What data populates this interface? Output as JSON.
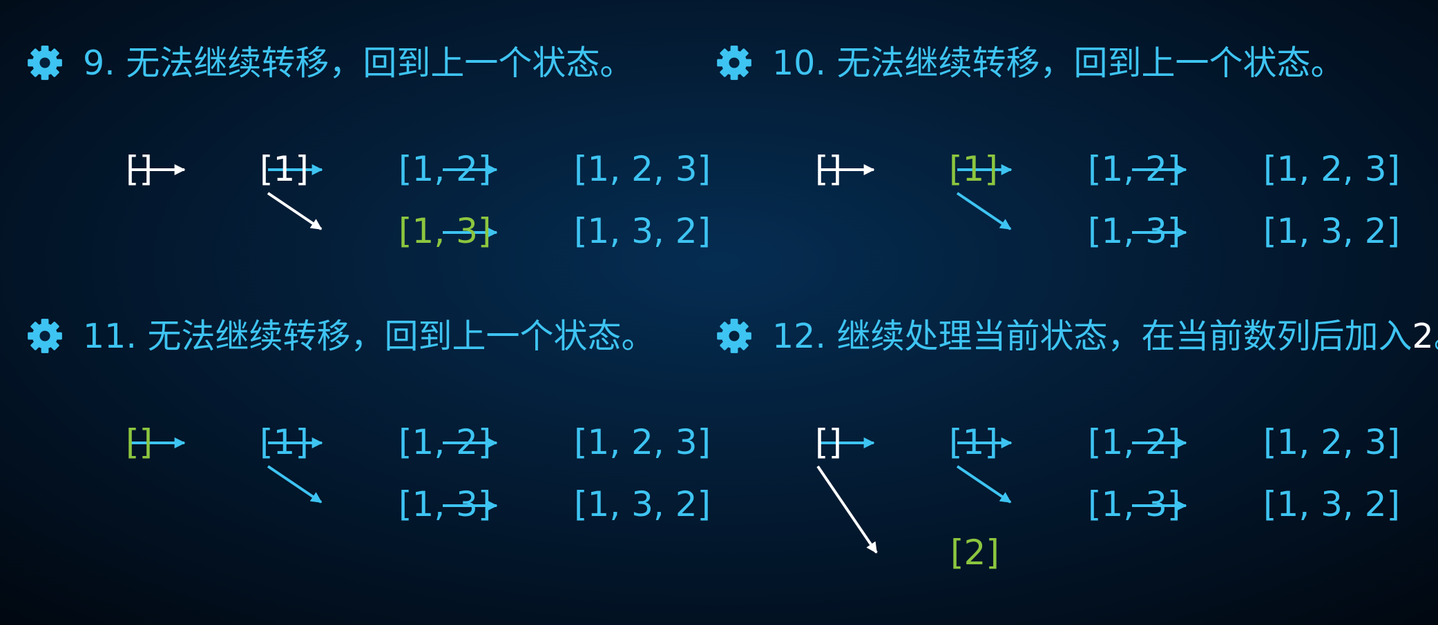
{
  "panels": [
    {
      "title": "9. 无法继续转移，回到上一个状态。",
      "nodes": [
        {
          "id": "empty",
          "label": "[]",
          "color": "white"
        },
        {
          "id": "n1",
          "label": "[1]",
          "color": "white"
        },
        {
          "id": "n12",
          "label": "[1, 2]",
          "color": "cyan"
        },
        {
          "id": "n123",
          "label": "[1, 2, 3]",
          "color": "cyan"
        },
        {
          "id": "n13",
          "label": "[1, 3]",
          "color": "green"
        },
        {
          "id": "n132",
          "label": "[1, 3, 2]",
          "color": "cyan"
        }
      ],
      "edges": [
        {
          "from": "empty",
          "to": "n1",
          "color": "white"
        },
        {
          "from": "n1",
          "to": "n12",
          "color": "cyan"
        },
        {
          "from": "n12",
          "to": "n123",
          "color": "cyan"
        },
        {
          "from": "n1",
          "to": "n13",
          "color": "white"
        },
        {
          "from": "n13",
          "to": "n132",
          "color": "cyan"
        }
      ]
    },
    {
      "title": "10. 无法继续转移，回到上一个状态。",
      "nodes": [
        {
          "id": "empty",
          "label": "[]",
          "color": "white"
        },
        {
          "id": "n1",
          "label": "[1]",
          "color": "green"
        },
        {
          "id": "n12",
          "label": "[1, 2]",
          "color": "cyan"
        },
        {
          "id": "n123",
          "label": "[1, 2, 3]",
          "color": "cyan"
        },
        {
          "id": "n13",
          "label": "[1, 3]",
          "color": "cyan"
        },
        {
          "id": "n132",
          "label": "[1, 3, 2]",
          "color": "cyan"
        }
      ],
      "edges": [
        {
          "from": "empty",
          "to": "n1",
          "color": "white"
        },
        {
          "from": "n1",
          "to": "n12",
          "color": "cyan"
        },
        {
          "from": "n12",
          "to": "n123",
          "color": "cyan"
        },
        {
          "from": "n1",
          "to": "n13",
          "color": "cyan"
        },
        {
          "from": "n13",
          "to": "n132",
          "color": "cyan"
        }
      ]
    },
    {
      "title": "11. 无法继续转移，回到上一个状态。",
      "nodes": [
        {
          "id": "empty",
          "label": "[]",
          "color": "green"
        },
        {
          "id": "n1",
          "label": "[1]",
          "color": "cyan"
        },
        {
          "id": "n12",
          "label": "[1, 2]",
          "color": "cyan"
        },
        {
          "id": "n123",
          "label": "[1, 2, 3]",
          "color": "cyan"
        },
        {
          "id": "n13",
          "label": "[1, 3]",
          "color": "cyan"
        },
        {
          "id": "n132",
          "label": "[1, 3, 2]",
          "color": "cyan"
        }
      ],
      "edges": [
        {
          "from": "empty",
          "to": "n1",
          "color": "cyan"
        },
        {
          "from": "n1",
          "to": "n12",
          "color": "cyan"
        },
        {
          "from": "n12",
          "to": "n123",
          "color": "cyan"
        },
        {
          "from": "n1",
          "to": "n13",
          "color": "cyan"
        },
        {
          "from": "n13",
          "to": "n132",
          "color": "cyan"
        }
      ]
    },
    {
      "title": "12. 继续处理当前状态，在当前数列后加入",
      "title_highlight": "2",
      "title_end": "。",
      "nodes": [
        {
          "id": "empty",
          "label": "[]",
          "color": "white"
        },
        {
          "id": "n1",
          "label": "[1]",
          "color": "cyan"
        },
        {
          "id": "n12",
          "label": "[1, 2]",
          "color": "cyan"
        },
        {
          "id": "n123",
          "label": "[1, 2, 3]",
          "color": "cyan"
        },
        {
          "id": "n13",
          "label": "[1, 3]",
          "color": "cyan"
        },
        {
          "id": "n132",
          "label": "[1, 3, 2]",
          "color": "cyan"
        },
        {
          "id": "n2",
          "label": "[2]",
          "color": "green"
        }
      ],
      "edges": [
        {
          "from": "empty",
          "to": "n1",
          "color": "cyan"
        },
        {
          "from": "n1",
          "to": "n12",
          "color": "cyan"
        },
        {
          "from": "n12",
          "to": "n123",
          "color": "cyan"
        },
        {
          "from": "n1",
          "to": "n13",
          "color": "cyan"
        },
        {
          "from": "n13",
          "to": "n132",
          "color": "cyan"
        },
        {
          "from": "empty",
          "to": "n2",
          "color": "white"
        }
      ]
    }
  ],
  "colors": {
    "white": "#ffffff",
    "cyan": "#3ec4f2",
    "green": "#8cc63f"
  },
  "icons": {
    "title_bullet": "gear-icon"
  }
}
